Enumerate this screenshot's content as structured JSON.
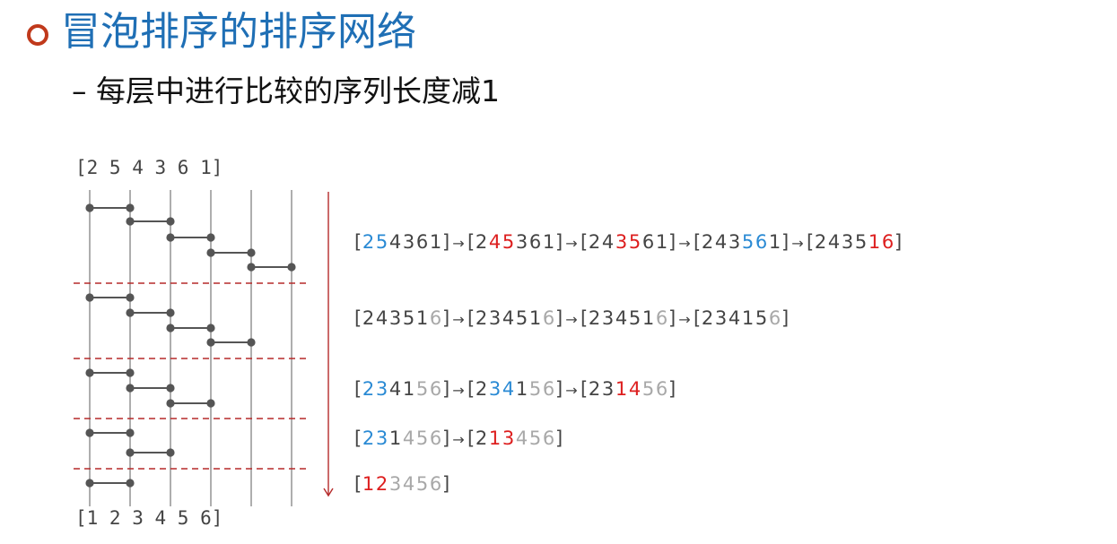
{
  "slide": {
    "title": "冒泡排序的排序网络",
    "subtitle": "– 每层中进行比较的序列长度减1"
  },
  "colors": {
    "title": "#1f6fb5",
    "bullet": "#c0391b",
    "swapped": "#dd1e1e",
    "compared": "#2a8ad4",
    "sorted": "#a8a8a8",
    "normal": "#444444",
    "layer_separator": "#b52a2a"
  },
  "network": {
    "input_label": "[2  5  4  3  6  1]",
    "output_label": "[1  2  3  4  5  6]",
    "wires": 6,
    "layers": [
      [
        [
          1,
          2
        ],
        [
          2,
          3
        ],
        [
          3,
          4
        ],
        [
          4,
          5
        ],
        [
          5,
          6
        ]
      ],
      [
        [
          1,
          2
        ],
        [
          2,
          3
        ],
        [
          3,
          4
        ],
        [
          4,
          5
        ]
      ],
      [
        [
          1,
          2
        ],
        [
          2,
          3
        ],
        [
          3,
          4
        ]
      ],
      [
        [
          1,
          2
        ],
        [
          2,
          3
        ]
      ],
      [
        [
          1,
          2
        ]
      ]
    ]
  },
  "sequences": [
    {
      "steps": [
        {
          "digits": [
            "2",
            "5",
            "4",
            "3",
            "6",
            "1"
          ],
          "marks": [
            "c",
            "c",
            "n",
            "n",
            "n",
            "n"
          ]
        },
        {
          "digits": [
            "2",
            "4",
            "5",
            "3",
            "6",
            "1"
          ],
          "marks": [
            "n",
            "s",
            "s",
            "n",
            "n",
            "n"
          ]
        },
        {
          "digits": [
            "2",
            "4",
            "3",
            "5",
            "6",
            "1"
          ],
          "marks": [
            "n",
            "n",
            "s",
            "s",
            "n",
            "n"
          ]
        },
        {
          "digits": [
            "2",
            "4",
            "3",
            "5",
            "6",
            "1"
          ],
          "marks": [
            "n",
            "n",
            "n",
            "c",
            "c",
            "n"
          ]
        },
        {
          "digits": [
            "2",
            "4",
            "3",
            "5",
            "1",
            "6"
          ],
          "marks": [
            "n",
            "n",
            "n",
            "n",
            "s",
            "s"
          ]
        }
      ]
    },
    {
      "steps": [
        {
          "digits": [
            "2",
            "4",
            "3",
            "5",
            "1",
            "6"
          ],
          "marks": [
            "n",
            "n",
            "n",
            "n",
            "n",
            "g"
          ]
        },
        {
          "digits": [
            "2",
            "3",
            "4",
            "5",
            "1",
            "6"
          ],
          "marks": [
            "n",
            "n",
            "n",
            "n",
            "n",
            "g"
          ]
        },
        {
          "digits": [
            "2",
            "3",
            "4",
            "5",
            "1",
            "6"
          ],
          "marks": [
            "n",
            "n",
            "n",
            "n",
            "n",
            "g"
          ]
        },
        {
          "digits": [
            "2",
            "3",
            "4",
            "1",
            "5",
            "6"
          ],
          "marks": [
            "n",
            "n",
            "n",
            "n",
            "n",
            "g"
          ]
        }
      ]
    },
    {
      "steps": [
        {
          "digits": [
            "2",
            "3",
            "4",
            "1",
            "5",
            "6"
          ],
          "marks": [
            "c",
            "c",
            "n",
            "n",
            "g",
            "g"
          ]
        },
        {
          "digits": [
            "2",
            "3",
            "4",
            "1",
            "5",
            "6"
          ],
          "marks": [
            "n",
            "c",
            "c",
            "n",
            "g",
            "g"
          ]
        },
        {
          "digits": [
            "2",
            "3",
            "1",
            "4",
            "5",
            "6"
          ],
          "marks": [
            "n",
            "n",
            "s",
            "s",
            "g",
            "g"
          ]
        }
      ]
    },
    {
      "steps": [
        {
          "digits": [
            "2",
            "3",
            "1",
            "4",
            "5",
            "6"
          ],
          "marks": [
            "c",
            "c",
            "n",
            "g",
            "g",
            "g"
          ]
        },
        {
          "digits": [
            "2",
            "1",
            "3",
            "4",
            "5",
            "6"
          ],
          "marks": [
            "n",
            "s",
            "s",
            "g",
            "g",
            "g"
          ]
        }
      ]
    },
    {
      "steps": [
        {
          "digits": [
            "1",
            "2",
            "3",
            "4",
            "5",
            "6"
          ],
          "marks": [
            "s",
            "s",
            "g",
            "g",
            "g",
            "g"
          ]
        }
      ]
    }
  ]
}
